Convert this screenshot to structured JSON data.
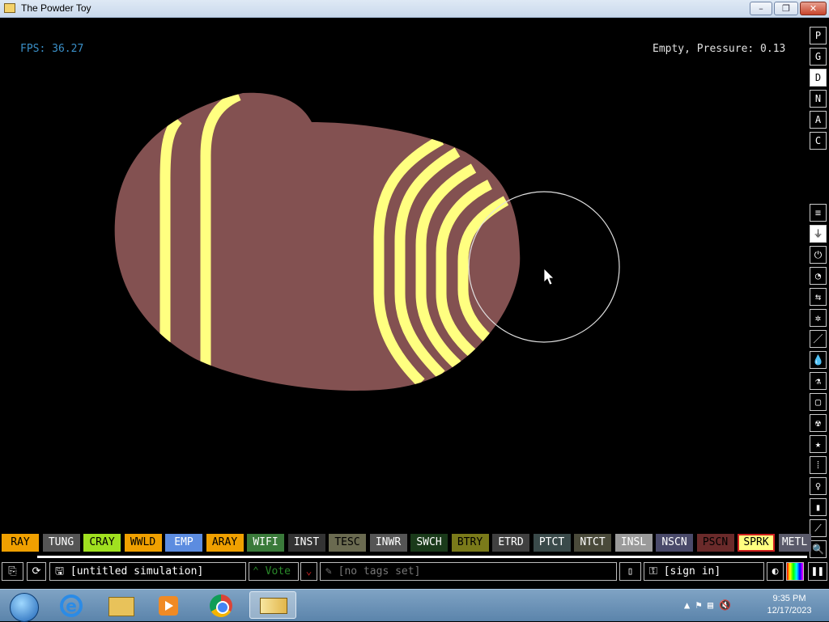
{
  "window": {
    "title": "The Powder Toy",
    "min": "–",
    "max": "❐",
    "close": "✕"
  },
  "hud": {
    "fps": "FPS: 36.27",
    "status": "Empty, Pressure: 0.13"
  },
  "side_top": [
    "P",
    "G",
    "D",
    "N",
    "A",
    "C"
  ],
  "side_top_active": "D",
  "side_tools": [
    "≡",
    "⏚",
    "⏻",
    "◔",
    "⇆",
    "✲",
    "／",
    "💧",
    "⚗",
    "▢",
    "☢",
    "★",
    "⁞",
    "♀",
    "▮",
    "⟋",
    "🔍"
  ],
  "elements": [
    {
      "label": "RAY",
      "bg": "#f0a000",
      "fg": "#000"
    },
    {
      "label": "TUNG",
      "bg": "#555555",
      "fg": "#fff"
    },
    {
      "label": "CRAY",
      "bg": "#a0e020",
      "fg": "#000"
    },
    {
      "label": "WWLD",
      "bg": "#f0a000",
      "fg": "#000"
    },
    {
      "label": "EMP",
      "bg": "#5c8ce0",
      "fg": "#fff"
    },
    {
      "label": "ARAY",
      "bg": "#f0a000",
      "fg": "#000"
    },
    {
      "label": "WIFI",
      "bg": "#3a7a3a",
      "fg": "#fff"
    },
    {
      "label": "INST",
      "bg": "#333333",
      "fg": "#fff"
    },
    {
      "label": "TESC",
      "bg": "#6a6a50",
      "fg": "#000"
    },
    {
      "label": "INWR",
      "bg": "#555555",
      "fg": "#fff"
    },
    {
      "label": "SWCH",
      "bg": "#1a3a1a",
      "fg": "#fff"
    },
    {
      "label": "BTRY",
      "bg": "#7a7a1a",
      "fg": "#000"
    },
    {
      "label": "ETRD",
      "bg": "#404040",
      "fg": "#fff"
    },
    {
      "label": "PTCT",
      "bg": "#3a4a4a",
      "fg": "#fff"
    },
    {
      "label": "NTCT",
      "bg": "#4a4a3a",
      "fg": "#fff"
    },
    {
      "label": "INSL",
      "bg": "#9a9a9a",
      "fg": "#fff"
    },
    {
      "label": "NSCN",
      "bg": "#4a4a6a",
      "fg": "#fff"
    },
    {
      "label": "PSCN",
      "bg": "#6a2a2a",
      "fg": "#000"
    },
    {
      "label": "SPRK",
      "bg": "#ffff80",
      "fg": "#000"
    },
    {
      "label": "METL",
      "bg": "#5a5a6a",
      "fg": "#fff"
    }
  ],
  "selected_element": "SPRK",
  "bottom": {
    "save_icon": "⎘",
    "reload_icon": "⟳",
    "sim_name": "[untitled simulation]",
    "vote": "Vote",
    "tags": "[no tags set]",
    "signin": "[sign in]",
    "pause_icon": "❚❚"
  },
  "taskbar": {
    "time": "9:35 PM",
    "date": "12/17/2023",
    "items": [
      "start-orb",
      "internet-explorer",
      "file-explorer",
      "media-player",
      "chrome",
      "powder-toy"
    ]
  },
  "colors": {
    "wall": "#835151",
    "spark": "#ffff80",
    "fps": "#3a8fc7"
  }
}
